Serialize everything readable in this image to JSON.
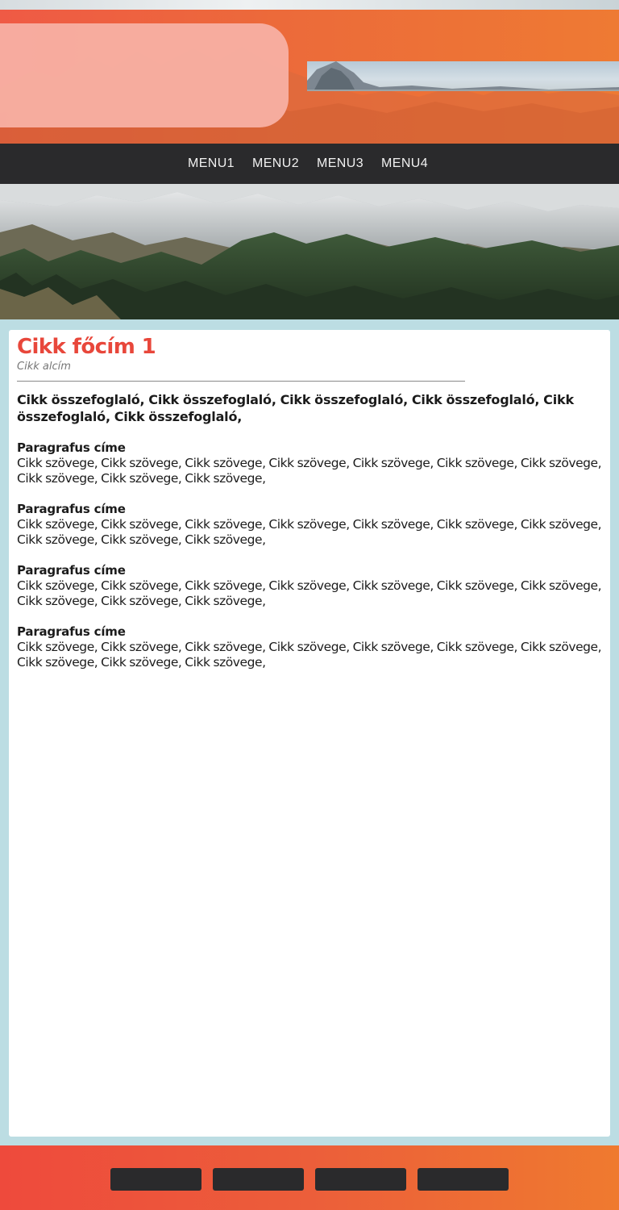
{
  "nav": {
    "items": [
      "MENU1",
      "MENU2",
      "MENU3",
      "MENU4"
    ]
  },
  "article": {
    "title": "Cikk főcím 1",
    "subtitle": "Cikk alcím",
    "summary": "Cikk összefoglaló, Cikk összefoglaló, Cikk összefoglaló, Cikk összefoglaló, Cikk összefoglaló, Cikk összefoglaló,",
    "paragraphs": [
      {
        "title": "Paragrafus címe",
        "text": "Cikk szövege, Cikk szövege, Cikk szövege, Cikk szövege, Cikk szövege, Cikk szövege, Cikk szövege, Cikk szövege, Cikk szövege, Cikk szövege,"
      },
      {
        "title": "Paragrafus címe",
        "text": "Cikk szövege, Cikk szövege, Cikk szövege, Cikk szövege, Cikk szövege, Cikk szövege, Cikk szövege, Cikk szövege, Cikk szövege, Cikk szövege,"
      },
      {
        "title": "Paragrafus címe",
        "text": "Cikk szövege, Cikk szövege, Cikk szövege, Cikk szövege, Cikk szövege, Cikk szövege, Cikk szövege, Cikk szövege, Cikk szövege, Cikk szövege,"
      },
      {
        "title": "Paragrafus címe",
        "text": "Cikk szövege, Cikk szövege, Cikk szövege, Cikk szövege, Cikk szövege, Cikk szövege, Cikk szövege, Cikk szövege, Cikk szövege, Cikk szövege,"
      }
    ]
  },
  "colors": {
    "accent": "#e8473b",
    "nav_bg": "#2a2a2c",
    "page_bg": "#bcdde3",
    "gradient_start": "#ef4a3c",
    "gradient_end": "#ef7a2f"
  },
  "footer": {
    "button_count": 4
  }
}
